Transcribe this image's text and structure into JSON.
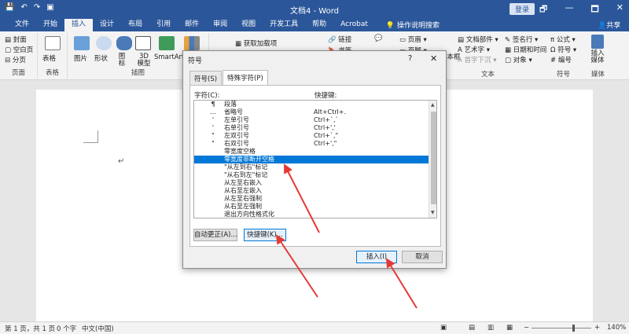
{
  "titlebar": {
    "doc_title": "文档4 - Word",
    "login_label": "登录",
    "qat": [
      "💾",
      "↶",
      "↷",
      "▣"
    ],
    "window_buttons": [
      "🗗",
      "—",
      "🗖",
      "✕"
    ]
  },
  "tabs": {
    "items": [
      "文件",
      "开始",
      "插入",
      "设计",
      "布局",
      "引用",
      "邮件",
      "审阅",
      "视图",
      "开发工具",
      "帮助",
      "Acrobat"
    ],
    "active_index": 2,
    "search": "操作说明搜索",
    "share": "共享"
  },
  "ribbon": {
    "pages_items": [
      "封面",
      "空白页",
      "分页"
    ],
    "pages_label": "页面",
    "table_label": "表格",
    "table_group_label": "表格",
    "picture_label": "图片",
    "shapes_label": "形状",
    "icons_label": "图标",
    "model_label": "3D 模型",
    "smartart_label": "SmartArt",
    "illustrations_label": "插图",
    "addins_label": "获取加载项",
    "links_label": "链接",
    "bookmark_label": "书签",
    "header_label": "页眉",
    "footer_label": "页脚",
    "textbox_label": "文本框",
    "docparts_label": "文档部件",
    "wordart_label": "艺术字",
    "dropcap_label": "首字下沉",
    "signature_label": "签名行",
    "datetime_label": "日期和时间",
    "object_label": "对象",
    "text_group_label": "文本",
    "equation_label": "公式",
    "symbol_label": "符号",
    "number_label": "编号",
    "symbols_group_label": "符号",
    "media_label": "插入媒体",
    "media_group_label": "媒体"
  },
  "status": {
    "page": "第 1 页，共 1 页",
    "words": "0 个字",
    "language": "中文(中国)",
    "zoom": "140%",
    "zoom_minus": "−",
    "zoom_plus": "+"
  },
  "dialog": {
    "title": "符号",
    "help": "?",
    "close": "✕",
    "tabs": [
      "符号(S)",
      "特殊字符(P)"
    ],
    "active_tab": 1,
    "char_label": "字符(C):",
    "key_label": "快捷键:",
    "rows": [
      {
        "symbol": "¶",
        "name": "段落",
        "key": ""
      },
      {
        "symbol": "…",
        "name": "省略号",
        "key": "Alt+Ctrl+."
      },
      {
        "symbol": "'",
        "name": "左单引号",
        "key": "Ctrl+`,`"
      },
      {
        "symbol": "'",
        "name": "右单引号",
        "key": "Ctrl+','"
      },
      {
        "symbol": "\"",
        "name": "左双引号",
        "key": "Ctrl+`,\""
      },
      {
        "symbol": "\"",
        "name": "右双引号",
        "key": "Ctrl+',\""
      },
      {
        "symbol": "",
        "name": "零宽度空格",
        "key": ""
      },
      {
        "symbol": "",
        "name": "零宽度非断开空格",
        "key": ""
      },
      {
        "symbol": "",
        "name": "\"从左到右\"标记",
        "key": ""
      },
      {
        "symbol": "",
        "name": "\"从右到左\"标记",
        "key": ""
      },
      {
        "symbol": "",
        "name": "从左至右嵌入",
        "key": ""
      },
      {
        "symbol": "",
        "name": "从右至左嵌入",
        "key": ""
      },
      {
        "symbol": "",
        "name": "从左至右强制",
        "key": ""
      },
      {
        "symbol": "",
        "name": "从右至左强制",
        "key": ""
      },
      {
        "symbol": "",
        "name": "退出方向性格式化",
        "key": ""
      }
    ],
    "selected_row": 7,
    "autocorrect_button": "自动更正(A)...",
    "shortcut_button": "快捷键(K)...",
    "insert_button": "插入(I)",
    "cancel_button": "取消"
  },
  "colors": {
    "brand": "#2b579a",
    "selection": "#0078d7",
    "annotation_arrow": "#e53935"
  }
}
